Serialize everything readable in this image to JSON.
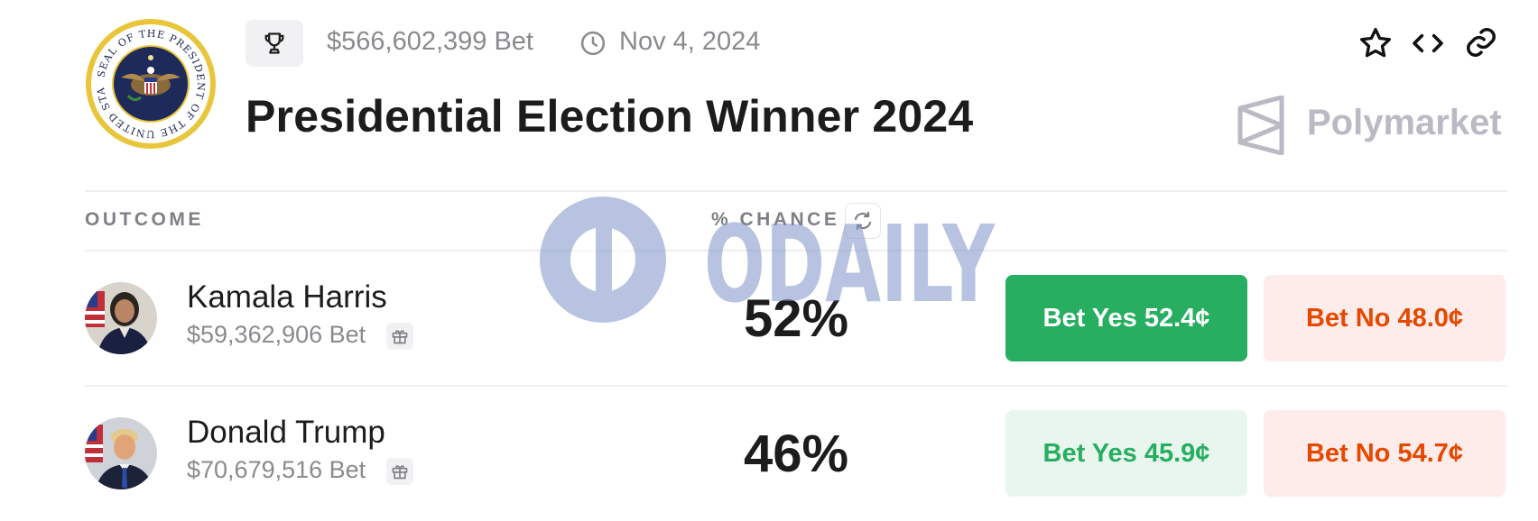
{
  "header": {
    "volume": "$566,602,399 Bet",
    "date": "Nov 4, 2024",
    "title": "Presidential Election Winner 2024",
    "brand": "Polymarket"
  },
  "table": {
    "col_outcome": "OUTCOME",
    "col_chance": "% CHANCE",
    "rows": [
      {
        "name": "Kamala Harris",
        "volume": "$59,362,906 Bet",
        "chance": "52%",
        "yes_label": "Bet Yes 52.4¢",
        "no_label": "Bet No 48.0¢"
      },
      {
        "name": "Donald Trump",
        "volume": "$70,679,516 Bet",
        "chance": "46%",
        "yes_label": "Bet Yes 45.9¢",
        "no_label": "Bet No 54.7¢"
      }
    ]
  },
  "seal_text": "SEAL OF THE PRESIDENT OF THE UNITED STATES",
  "watermark": "ODAILY",
  "colors": {
    "yes_green": "#27ae60",
    "no_red": "#e64800",
    "muted": "#8a8a8f"
  },
  "icons": [
    "trophy-icon",
    "clock-icon",
    "star-icon",
    "code-icon",
    "link-icon",
    "refresh-icon",
    "gift-icon"
  ]
}
